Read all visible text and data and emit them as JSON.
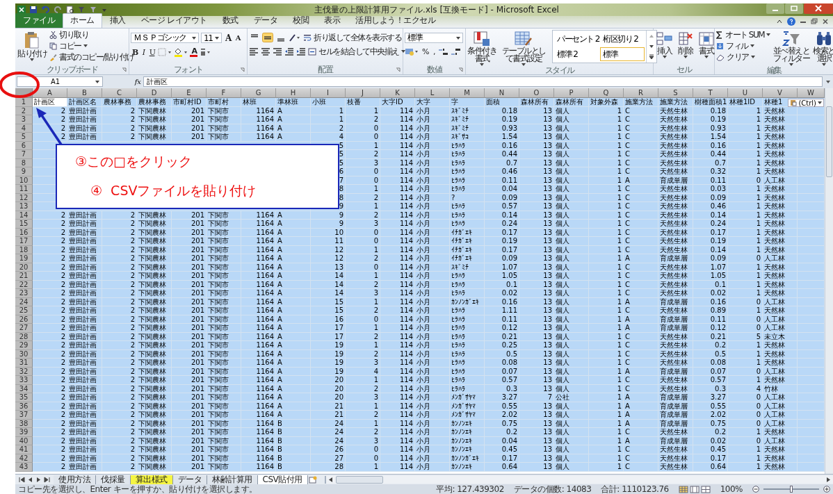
{
  "window": {
    "title": "主伐量の上限計算用ファイル.xls  [互換モード] - Microsoft Excel"
  },
  "tabs": [
    {
      "label": "ファイル",
      "kind": "file",
      "selected": false
    },
    {
      "label": "ホーム",
      "kind": "tab",
      "selected": true
    },
    {
      "label": "挿入",
      "kind": "tab",
      "selected": false
    },
    {
      "label": "ページ レイアウト",
      "kind": "tab",
      "selected": false
    },
    {
      "label": "数式",
      "kind": "tab",
      "selected": false
    },
    {
      "label": "データ",
      "kind": "tab",
      "selected": false
    },
    {
      "label": "校閲",
      "kind": "tab",
      "selected": false
    },
    {
      "label": "表示",
      "kind": "tab",
      "selected": false
    },
    {
      "label": "活用しよう！エクセル",
      "kind": "tab",
      "selected": false
    }
  ],
  "ribbon": {
    "clipboard": {
      "paste": "貼り付け",
      "cut": "切り取り",
      "copy": "コピー",
      "format_painter": "書式のコピー/貼り付け",
      "label": "クリップボード"
    },
    "font": {
      "name": "ＭＳ Ｐゴシック",
      "size": "11",
      "grow": "A",
      "shrink": "A",
      "bold": "B",
      "italic": "I",
      "underline": "U",
      "font_color": "A",
      "label": "フォント"
    },
    "alignment": {
      "vertical": [
        {
          "selected": false
        },
        {
          "selected": true
        },
        {
          "selected": false
        }
      ],
      "wrap": "折り返して全体を表示する",
      "merge": "セルを結合して中央揃え",
      "label": "配置"
    },
    "number": {
      "format": "標準",
      "percent": "%",
      "comma": ",",
      "label": "数値"
    },
    "styles": {
      "conditional": "条件付き書式",
      "table": "テーブルとして書式設定",
      "gallery": [
        {
          "label": "パーセント 2",
          "selected": false
        },
        {
          "label": "桁区切り 2",
          "selected": false
        },
        {
          "label": "標準 2",
          "selected": false
        },
        {
          "label": "標準",
          "selected": true
        }
      ],
      "label": "スタイル"
    },
    "cells": {
      "insert": "挿入",
      "delete": "削除",
      "format": "書式",
      "label": "セル"
    },
    "editing": {
      "autosum": "オート SUM",
      "fill": "フィル",
      "clear": "クリア",
      "sort": "並べ替えとフィルター",
      "find": "検索と選択",
      "label": "編集"
    }
  },
  "formula_bar": {
    "name_box": "A1",
    "fx": "fx",
    "value": "計画区"
  },
  "sheet": {
    "columns": [
      {
        "letter": "A",
        "title": "計画区",
        "kind": "number",
        "active": true
      },
      {
        "letter": "B",
        "title": "計画区名",
        "kind": "text",
        "active": false
      },
      {
        "letter": "C",
        "title": "農林事務",
        "kind": "number",
        "active": false
      },
      {
        "letter": "D",
        "title": "農林事務",
        "kind": "text",
        "active": false
      },
      {
        "letter": "E",
        "title": "市町村ID",
        "kind": "number",
        "active": false
      },
      {
        "letter": "F",
        "title": "市町村",
        "kind": "text",
        "active": false
      },
      {
        "letter": "G",
        "title": "林班",
        "kind": "number",
        "active": false
      },
      {
        "letter": "H",
        "title": "準林班",
        "kind": "text",
        "active": false
      },
      {
        "letter": "I",
        "title": "小班",
        "kind": "number",
        "active": false
      },
      {
        "letter": "J",
        "title": "枝番",
        "kind": "number",
        "active": false
      },
      {
        "letter": "K",
        "title": "大字ID",
        "kind": "number",
        "active": false
      },
      {
        "letter": "L",
        "title": "大字",
        "kind": "text",
        "active": false
      },
      {
        "letter": "M",
        "title": "字",
        "kind": "text",
        "active": false
      },
      {
        "letter": "N",
        "title": "面積",
        "kind": "number",
        "active": false
      },
      {
        "letter": "O",
        "title": "森林所有",
        "kind": "number",
        "active": false
      },
      {
        "letter": "P",
        "title": "森林所有",
        "kind": "text",
        "active": false
      },
      {
        "letter": "Q",
        "title": "対象外森",
        "kind": "number",
        "active": false
      },
      {
        "letter": "R",
        "title": "施業方法",
        "kind": "text",
        "active": false
      },
      {
        "letter": "S",
        "title": "施業方法",
        "kind": "text",
        "active": false
      },
      {
        "letter": "T",
        "title": "樹種面積1",
        "kind": "number",
        "active": false
      },
      {
        "letter": "U",
        "title": "林種1ID",
        "kind": "number",
        "active": false
      },
      {
        "letter": "V",
        "title": "林種1",
        "kind": "text",
        "active": false
      }
    ],
    "extra_column": "W",
    "title_row_header": "1",
    "rows": [
      {
        "header": "2",
        "cells": [
          "2",
          "豊田計画",
          "2",
          "下関農林",
          "201",
          "下関市",
          "1164",
          "A",
          "1",
          "1",
          "114",
          "小月",
          "ｽｷﾞﾐﾁ",
          "0.18",
          "13",
          "個人",
          "1",
          "C",
          "天然生林",
          "0.18",
          "1",
          "天然林"
        ]
      },
      {
        "header": "3",
        "cells": [
          "2",
          "豊田計画",
          "2",
          "下関農林",
          "201",
          "下関市",
          "1164",
          "A",
          "1",
          "2",
          "114",
          "小月",
          "ｽｷﾞﾐﾁ",
          "0.19",
          "13",
          "個人",
          "1",
          "C",
          "天然生林",
          "0.19",
          "1",
          "天然林"
        ]
      },
      {
        "header": "4",
        "cells": [
          "2",
          "豊田計画",
          "2",
          "下関農林",
          "201",
          "下関市",
          "1164",
          "A",
          "2",
          "0",
          "114",
          "小月",
          "ｽｷﾞﾐﾁ",
          "0.93",
          "13",
          "個人",
          "1",
          "C",
          "天然生林",
          "0.93",
          "1",
          "天然林"
        ]
      },
      {
        "header": "5",
        "cells": [
          "2",
          "豊田計画",
          "2",
          "下関農林",
          "201",
          "下関市",
          "1164",
          "A",
          "4",
          "0",
          "114",
          "小月",
          "ｽｷﾞｻｺ",
          "1.54",
          "13",
          "個人",
          "1",
          "C",
          "天然生林",
          "1.54",
          "1",
          "天然林"
        ]
      },
      {
        "header": "6",
        "cells": [
          "5",
          "1",
          "114",
          "小月",
          "ﾋﾗﾊﾗ",
          "0.16",
          "13",
          "個人",
          "1",
          "C",
          "天然生林",
          "0.16",
          "1",
          "天然林"
        ]
      },
      {
        "header": "7",
        "cells": [
          "5",
          "2",
          "114",
          "小月",
          "ﾋﾗﾊﾗ",
          "0.44",
          "13",
          "個人",
          "1",
          "C",
          "天然生林",
          "0.44",
          "1",
          "天然林"
        ]
      },
      {
        "header": "8",
        "cells": [
          "5",
          "3",
          "114",
          "小月",
          "ﾋﾗﾊﾗ",
          "0.7",
          "13",
          "個人",
          "1",
          "C",
          "天然生林",
          "0.7",
          "1",
          "天然林"
        ]
      },
      {
        "header": "9",
        "cells": [
          "6",
          "0",
          "114",
          "小月",
          "ﾋﾗﾊﾗ",
          "0.46",
          "13",
          "個人",
          "1",
          "C",
          "天然生林",
          "0.32",
          "1",
          "天然林"
        ]
      },
      {
        "header": "10",
        "cells": [
          "7",
          "0",
          "114",
          "小月",
          "ﾋﾗﾊﾗ",
          "0.11",
          "13",
          "個人",
          "1",
          "A",
          "育成単層",
          "0.11",
          "0",
          "人工林"
        ]
      },
      {
        "header": "11",
        "cells": [
          "8",
          "1",
          "114",
          "小月",
          "ﾋﾗﾊﾗ",
          "0.04",
          "13",
          "個人",
          "1",
          "C",
          "天然生林",
          "0.03",
          "1",
          "天然林"
        ]
      },
      {
        "header": "12",
        "cells": [
          "8",
          "2",
          "114",
          "小月",
          "?",
          "0.09",
          "13",
          "個人",
          "1",
          "C",
          "天然生林",
          "0.09",
          "1",
          "天然林"
        ]
      },
      {
        "header": "13",
        "cells": [
          "9",
          "1",
          "114",
          "小月",
          "ﾋﾗﾊﾗ",
          "0.57",
          "13",
          "個人",
          "1",
          "C",
          "天然生林",
          "0.46",
          "1",
          "天然林"
        ]
      },
      {
        "header": "14",
        "cells": [
          "2",
          "豊田計画",
          "2",
          "下関農林",
          "201",
          "下関市",
          "1164",
          "A",
          "9",
          "2",
          "114",
          "小月",
          "ﾋﾗﾊﾗ",
          "0.14",
          "13",
          "個人",
          "1",
          "C",
          "天然生林",
          "0.14",
          "1",
          "天然林"
        ]
      },
      {
        "header": "15",
        "cells": [
          "2",
          "豊田計画",
          "2",
          "下関農林",
          "201",
          "下関市",
          "1164",
          "A",
          "9",
          "3",
          "114",
          "小月",
          "ﾋﾗﾊﾗ",
          "0.24",
          "13",
          "個人",
          "1",
          "C",
          "天然生林",
          "0.24",
          "1",
          "天然林"
        ]
      },
      {
        "header": "16",
        "cells": [
          "2",
          "豊田計画",
          "2",
          "下関農林",
          "201",
          "下関市",
          "1164",
          "A",
          "10",
          "0",
          "114",
          "小月",
          "ｲﾁｶﾞｴｷ",
          "0.17",
          "13",
          "個人",
          "1",
          "C",
          "天然生林",
          "0.17",
          "1",
          "天然林"
        ]
      },
      {
        "header": "17",
        "cells": [
          "2",
          "豊田計画",
          "2",
          "下関農林",
          "201",
          "下関市",
          "1164",
          "A",
          "11",
          "0",
          "114",
          "小月",
          "ｲﾁｶﾞｴｷ",
          "0.19",
          "13",
          "個人",
          "1",
          "C",
          "天然生林",
          "0.19",
          "1",
          "天然林"
        ]
      },
      {
        "header": "18",
        "cells": [
          "2",
          "豊田計画",
          "2",
          "下関農林",
          "201",
          "下関市",
          "1164",
          "A",
          "12",
          "1",
          "114",
          "小月",
          "ｲﾁｶﾞｴｷ",
          "0.17",
          "13",
          "個人",
          "1",
          "C",
          "天然生林",
          "0.14",
          "1",
          "天然林"
        ]
      },
      {
        "header": "19",
        "cells": [
          "2",
          "豊田計画",
          "2",
          "下関農林",
          "201",
          "下関市",
          "1164",
          "A",
          "12",
          "2",
          "114",
          "小月",
          "ｲﾁｶﾞｴｷ",
          "0.09",
          "13",
          "個人",
          "1",
          "A",
          "育成単層",
          "0.09",
          "0",
          "人工林"
        ]
      },
      {
        "header": "20",
        "cells": [
          "2",
          "豊田計画",
          "2",
          "下関農林",
          "201",
          "下関市",
          "1164",
          "A",
          "13",
          "0",
          "114",
          "小月",
          "ｽｷﾞﾐﾁ",
          "1.07",
          "13",
          "個人",
          "1",
          "C",
          "天然生林",
          "1.07",
          "1",
          "天然林"
        ]
      },
      {
        "header": "21",
        "cells": [
          "2",
          "豊田計画",
          "2",
          "下関農林",
          "201",
          "下関市",
          "1164",
          "A",
          "14",
          "1",
          "114",
          "小月",
          "ﾋﾗﾊﾗ",
          "1.05",
          "13",
          "個人",
          "1",
          "C",
          "天然生林",
          "1.05",
          "1",
          "天然林"
        ]
      },
      {
        "header": "22",
        "cells": [
          "2",
          "豊田計画",
          "2",
          "下関農林",
          "201",
          "下関市",
          "1164",
          "A",
          "14",
          "2",
          "114",
          "小月",
          "ﾋﾗﾊﾗ",
          "0.1",
          "13",
          "個人",
          "1",
          "C",
          "天然生林",
          "0.1",
          "1",
          "天然林"
        ]
      },
      {
        "header": "23",
        "cells": [
          "2",
          "豊田計画",
          "2",
          "下関農林",
          "201",
          "下関市",
          "1164",
          "A",
          "14",
          "3",
          "114",
          "小月",
          "ﾋﾗﾊﾗ",
          "0.02",
          "13",
          "個人",
          "1",
          "C",
          "天然生林",
          "0.02",
          "1",
          "天然林"
        ]
      },
      {
        "header": "24",
        "cells": [
          "2",
          "豊田計画",
          "2",
          "下関農林",
          "201",
          "下関市",
          "1164",
          "A",
          "15",
          "1",
          "114",
          "小月",
          "ｶﾝﾉﾝｶﾞｴｷ",
          "0.16",
          "13",
          "個人",
          "1",
          "A",
          "育成単層",
          "0.16",
          "0",
          "人工林"
        ]
      },
      {
        "header": "25",
        "cells": [
          "2",
          "豊田計画",
          "2",
          "下関農林",
          "201",
          "下関市",
          "1164",
          "A",
          "15",
          "2",
          "114",
          "小月",
          "ﾋﾗﾊﾗ",
          "1.11",
          "13",
          "個人",
          "1",
          "C",
          "天然生林",
          "0.89",
          "1",
          "天然林"
        ]
      },
      {
        "header": "26",
        "cells": [
          "2",
          "豊田計画",
          "2",
          "下関農林",
          "201",
          "下関市",
          "1164",
          "A",
          "16",
          "0",
          "114",
          "小月",
          "ﾋﾗﾊﾗ",
          "0.11",
          "13",
          "個人",
          "1",
          "A",
          "育成単層",
          "0.11",
          "0",
          "人工林"
        ]
      },
      {
        "header": "27",
        "cells": [
          "2",
          "豊田計画",
          "2",
          "下関農林",
          "201",
          "下関市",
          "1164",
          "A",
          "17",
          "1",
          "114",
          "小月",
          "ﾋﾗﾊﾗ",
          "0.12",
          "13",
          "個人",
          "1",
          "A",
          "育成単層",
          "0.12",
          "0",
          "人工林"
        ]
      },
      {
        "header": "28",
        "cells": [
          "2",
          "豊田計画",
          "2",
          "下関農林",
          "201",
          "下関市",
          "1164",
          "A",
          "17",
          "2",
          "114",
          "小月",
          "ﾋﾗﾊﾗ",
          "0.21",
          "13",
          "個人",
          "1",
          "C",
          "天然生林",
          "0.21",
          "5",
          "未立木"
        ]
      },
      {
        "header": "29",
        "cells": [
          "2",
          "豊田計画",
          "2",
          "下関農林",
          "201",
          "下関市",
          "1164",
          "A",
          "19",
          "1",
          "114",
          "小月",
          "ﾋﾗﾊﾗ",
          "0.25",
          "13",
          "個人",
          "1",
          "C",
          "天然生林",
          "0.2",
          "1",
          "天然林"
        ]
      },
      {
        "header": "30",
        "cells": [
          "2",
          "豊田計画",
          "2",
          "下関農林",
          "201",
          "下関市",
          "1164",
          "A",
          "19",
          "2",
          "114",
          "小月",
          "ﾋﾗﾊﾗ",
          "0.5",
          "13",
          "個人",
          "1",
          "C",
          "天然生林",
          "0.5",
          "1",
          "天然林"
        ]
      },
      {
        "header": "31",
        "cells": [
          "2",
          "豊田計画",
          "2",
          "下関農林",
          "201",
          "下関市",
          "1164",
          "A",
          "19",
          "3",
          "114",
          "小月",
          "ﾋﾗﾊﾗ",
          "0.08",
          "13",
          "個人",
          "1",
          "C",
          "天然生林",
          "0.08",
          "1",
          "天然林"
        ]
      },
      {
        "header": "32",
        "cells": [
          "2",
          "豊田計画",
          "2",
          "下関農林",
          "201",
          "下関市",
          "1164",
          "A",
          "19",
          "4",
          "114",
          "小月",
          "ﾋﾗﾊﾗ",
          "0.07",
          "13",
          "個人",
          "1",
          "A",
          "育成単層",
          "0.07",
          "0",
          "人工林"
        ]
      },
      {
        "header": "33",
        "cells": [
          "2",
          "豊田計画",
          "2",
          "下関農林",
          "201",
          "下関市",
          "1164",
          "A",
          "20",
          "1",
          "114",
          "小月",
          "ﾋﾗﾊﾗ",
          "0.57",
          "13",
          "個人",
          "1",
          "C",
          "天然生林",
          "0.57",
          "1",
          "天然林"
        ]
      },
      {
        "header": "34",
        "cells": [
          "2",
          "豊田計画",
          "2",
          "下関農林",
          "201",
          "下関市",
          "1164",
          "A",
          "20",
          "2",
          "114",
          "小月",
          "ﾋﾗﾊﾗ",
          "0.3",
          "13",
          "個人",
          "1",
          "C",
          "天然生林",
          "0.3",
          "4",
          "竹林"
        ]
      },
      {
        "header": "35",
        "cells": [
          "2",
          "豊田計画",
          "2",
          "下関農林",
          "201",
          "下関市",
          "1164",
          "A",
          "20",
          "3",
          "114",
          "小月",
          "ﾒﾝｶﾞｻﾔﾏ",
          "3.27",
          "7",
          "公社",
          "1",
          "A",
          "育成単層",
          "3.27",
          "0",
          "人工林"
        ]
      },
      {
        "header": "36",
        "cells": [
          "2",
          "豊田計画",
          "2",
          "下関農林",
          "201",
          "下関市",
          "1164",
          "A",
          "21",
          "1",
          "114",
          "小月",
          "ﾒﾝｶﾞｻﾔﾏ",
          "0.55",
          "13",
          "個人",
          "1",
          "A",
          "育成単層",
          "0.55",
          "0",
          "人工林"
        ]
      },
      {
        "header": "37",
        "cells": [
          "2",
          "豊田計画",
          "2",
          "下関農林",
          "201",
          "下関市",
          "1164",
          "A",
          "21",
          "2",
          "114",
          "小月",
          "ﾒﾝｶﾞｻﾔﾏ",
          "2.02",
          "13",
          "個人",
          "1",
          "A",
          "育成単層",
          "2.02",
          "0",
          "人工林"
        ]
      },
      {
        "header": "38",
        "cells": [
          "2",
          "豊田計画",
          "2",
          "下関農林",
          "201",
          "下関市",
          "1164",
          "B",
          "24",
          "1",
          "114",
          "小月",
          "ｶﾝﾉﾝｴｷ",
          "0.75",
          "13",
          "個人",
          "1",
          "A",
          "育成単層",
          "0.75",
          "0",
          "人工林"
        ]
      },
      {
        "header": "39",
        "cells": [
          "2",
          "豊田計画",
          "2",
          "下関農林",
          "201",
          "下関市",
          "1164",
          "B",
          "24",
          "2",
          "114",
          "小月",
          "ｶﾝﾉﾝｴｷ",
          "0.2",
          "13",
          "個人",
          "1",
          "C",
          "天然生林",
          "0.2",
          "1",
          "天然林"
        ]
      },
      {
        "header": "40",
        "cells": [
          "2",
          "豊田計画",
          "2",
          "下関農林",
          "201",
          "下関市",
          "1164",
          "B",
          "24",
          "3",
          "114",
          "小月",
          "ｶﾝﾉﾝｴｷ",
          "0.04",
          "13",
          "個人",
          "1",
          "A",
          "育成単層",
          "0.02",
          "0",
          "人工林"
        ]
      },
      {
        "header": "41",
        "cells": [
          "2",
          "豊田計画",
          "2",
          "下関農林",
          "201",
          "下関市",
          "1164",
          "B",
          "26",
          "0",
          "114",
          "小月",
          "ｶﾝﾉﾝｴｷ",
          "0.45",
          "13",
          "個人",
          "1",
          "C",
          "天然生林",
          "0.45",
          "1",
          "天然林"
        ]
      },
      {
        "header": "42",
        "cells": [
          "2",
          "豊田計画",
          "2",
          "下関農林",
          "201",
          "下関市",
          "1164",
          "B",
          "27",
          "0",
          "114",
          "小月",
          "ｶﾝﾉﾝｶﾞｴｷ",
          "0.17",
          "13",
          "個人",
          "1",
          "C",
          "天然生林",
          "0.17",
          "1",
          "天然林"
        ]
      },
      {
        "header": "43",
        "cells": [
          "2",
          "豊田計画",
          "2",
          "下関農林",
          "201",
          "下関市",
          "1164",
          "B",
          "28",
          "1",
          "114",
          "小月",
          "ｶﾝﾉﾝｴｷ",
          "0.64",
          "13",
          "個人",
          "1",
          "C",
          "天然生林",
          "0.64",
          "1",
          "天然林"
        ]
      }
    ],
    "paste_options": "(Ctrl)"
  },
  "sheet_tabs": [
    {
      "label": "使用方法",
      "selected": false
    },
    {
      "label": "伐採量",
      "selected": false
    },
    {
      "label": "算出様式",
      "selected": false,
      "color": "#f5f542"
    },
    {
      "label": "データ",
      "selected": false
    },
    {
      "label": "林齢計算用",
      "selected": false
    },
    {
      "label": "CSV貼付用",
      "selected": true
    }
  ],
  "status_bar": {
    "message": "コピー先を選択し、Enter キーを押すか、貼り付けを選択します。",
    "average": "平均: 127.439302",
    "count": "データの個数: 14083",
    "sum": "合計: 1110123.76",
    "views": [
      {
        "selected": true
      },
      {
        "selected": false
      },
      {
        "selected": false
      }
    ],
    "zoom": "100%",
    "zoom_slider": {
      "level": 0.5
    }
  },
  "callout": {
    "lines": [
      "③この□をクリック",
      "④  CSVファイルを貼り付け"
    ]
  }
}
